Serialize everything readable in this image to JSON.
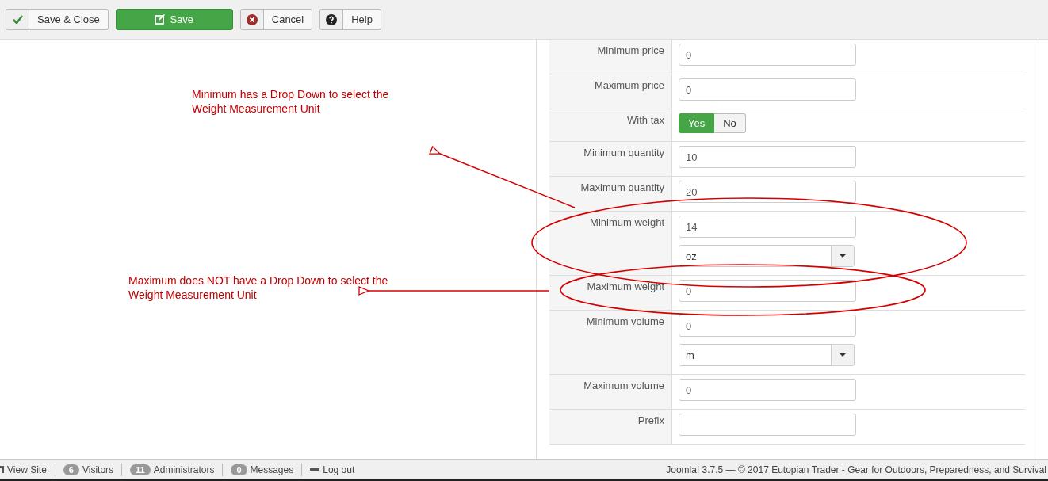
{
  "toolbar": [
    {
      "label": "Save & Close",
      "kind": "apply"
    },
    {
      "label": "Save",
      "kind": "save"
    },
    {
      "label": "Cancel",
      "kind": "cancel"
    },
    {
      "label": "Help",
      "kind": "help"
    }
  ],
  "form": {
    "rows": [
      {
        "label": "Minimum price",
        "kind": "input",
        "value": "0"
      },
      {
        "label": "Maximum price",
        "kind": "input",
        "value": "0"
      },
      {
        "label": "With tax",
        "kind": "toggle",
        "options": [
          {
            "label": "Yes",
            "selected": true
          },
          {
            "label": "No",
            "selected": false
          }
        ]
      },
      {
        "label": "Minimum quantity",
        "kind": "input",
        "value": "10"
      },
      {
        "label": "Maximum quantity",
        "kind": "input",
        "value": "20"
      },
      {
        "label": "Minimum weight",
        "kind": "input_select",
        "value": "14",
        "unit": "oz"
      },
      {
        "label": "Maximum weight",
        "kind": "input",
        "value": "0"
      },
      {
        "label": "Minimum volume",
        "kind": "input_select",
        "value": "0",
        "unit": "m"
      },
      {
        "label": "Maximum volume",
        "kind": "input",
        "value": "0"
      },
      {
        "label": "Prefix",
        "kind": "input"
      }
    ]
  },
  "annotations": [
    {
      "text": "Minimum has a Drop Down to select the Weight Measurement Unit"
    },
    {
      "text": "Maximum does NOT have a Drop Down to select the Weight Measurement Unit"
    }
  ],
  "status_bar": {
    "items": [
      {
        "label": "View Site",
        "kind": "link"
      },
      {
        "label": "Visitors",
        "count": "6"
      },
      {
        "label": "Administrators",
        "count": "11"
      },
      {
        "label": "Messages",
        "count": "0"
      },
      {
        "label": "Log out",
        "kind": "logout"
      }
    ],
    "footer": "Joomla! 3.7.5  —  © 2017 Eutopian Trader - Gear for Outdoors, Preparedness, and Survival"
  }
}
